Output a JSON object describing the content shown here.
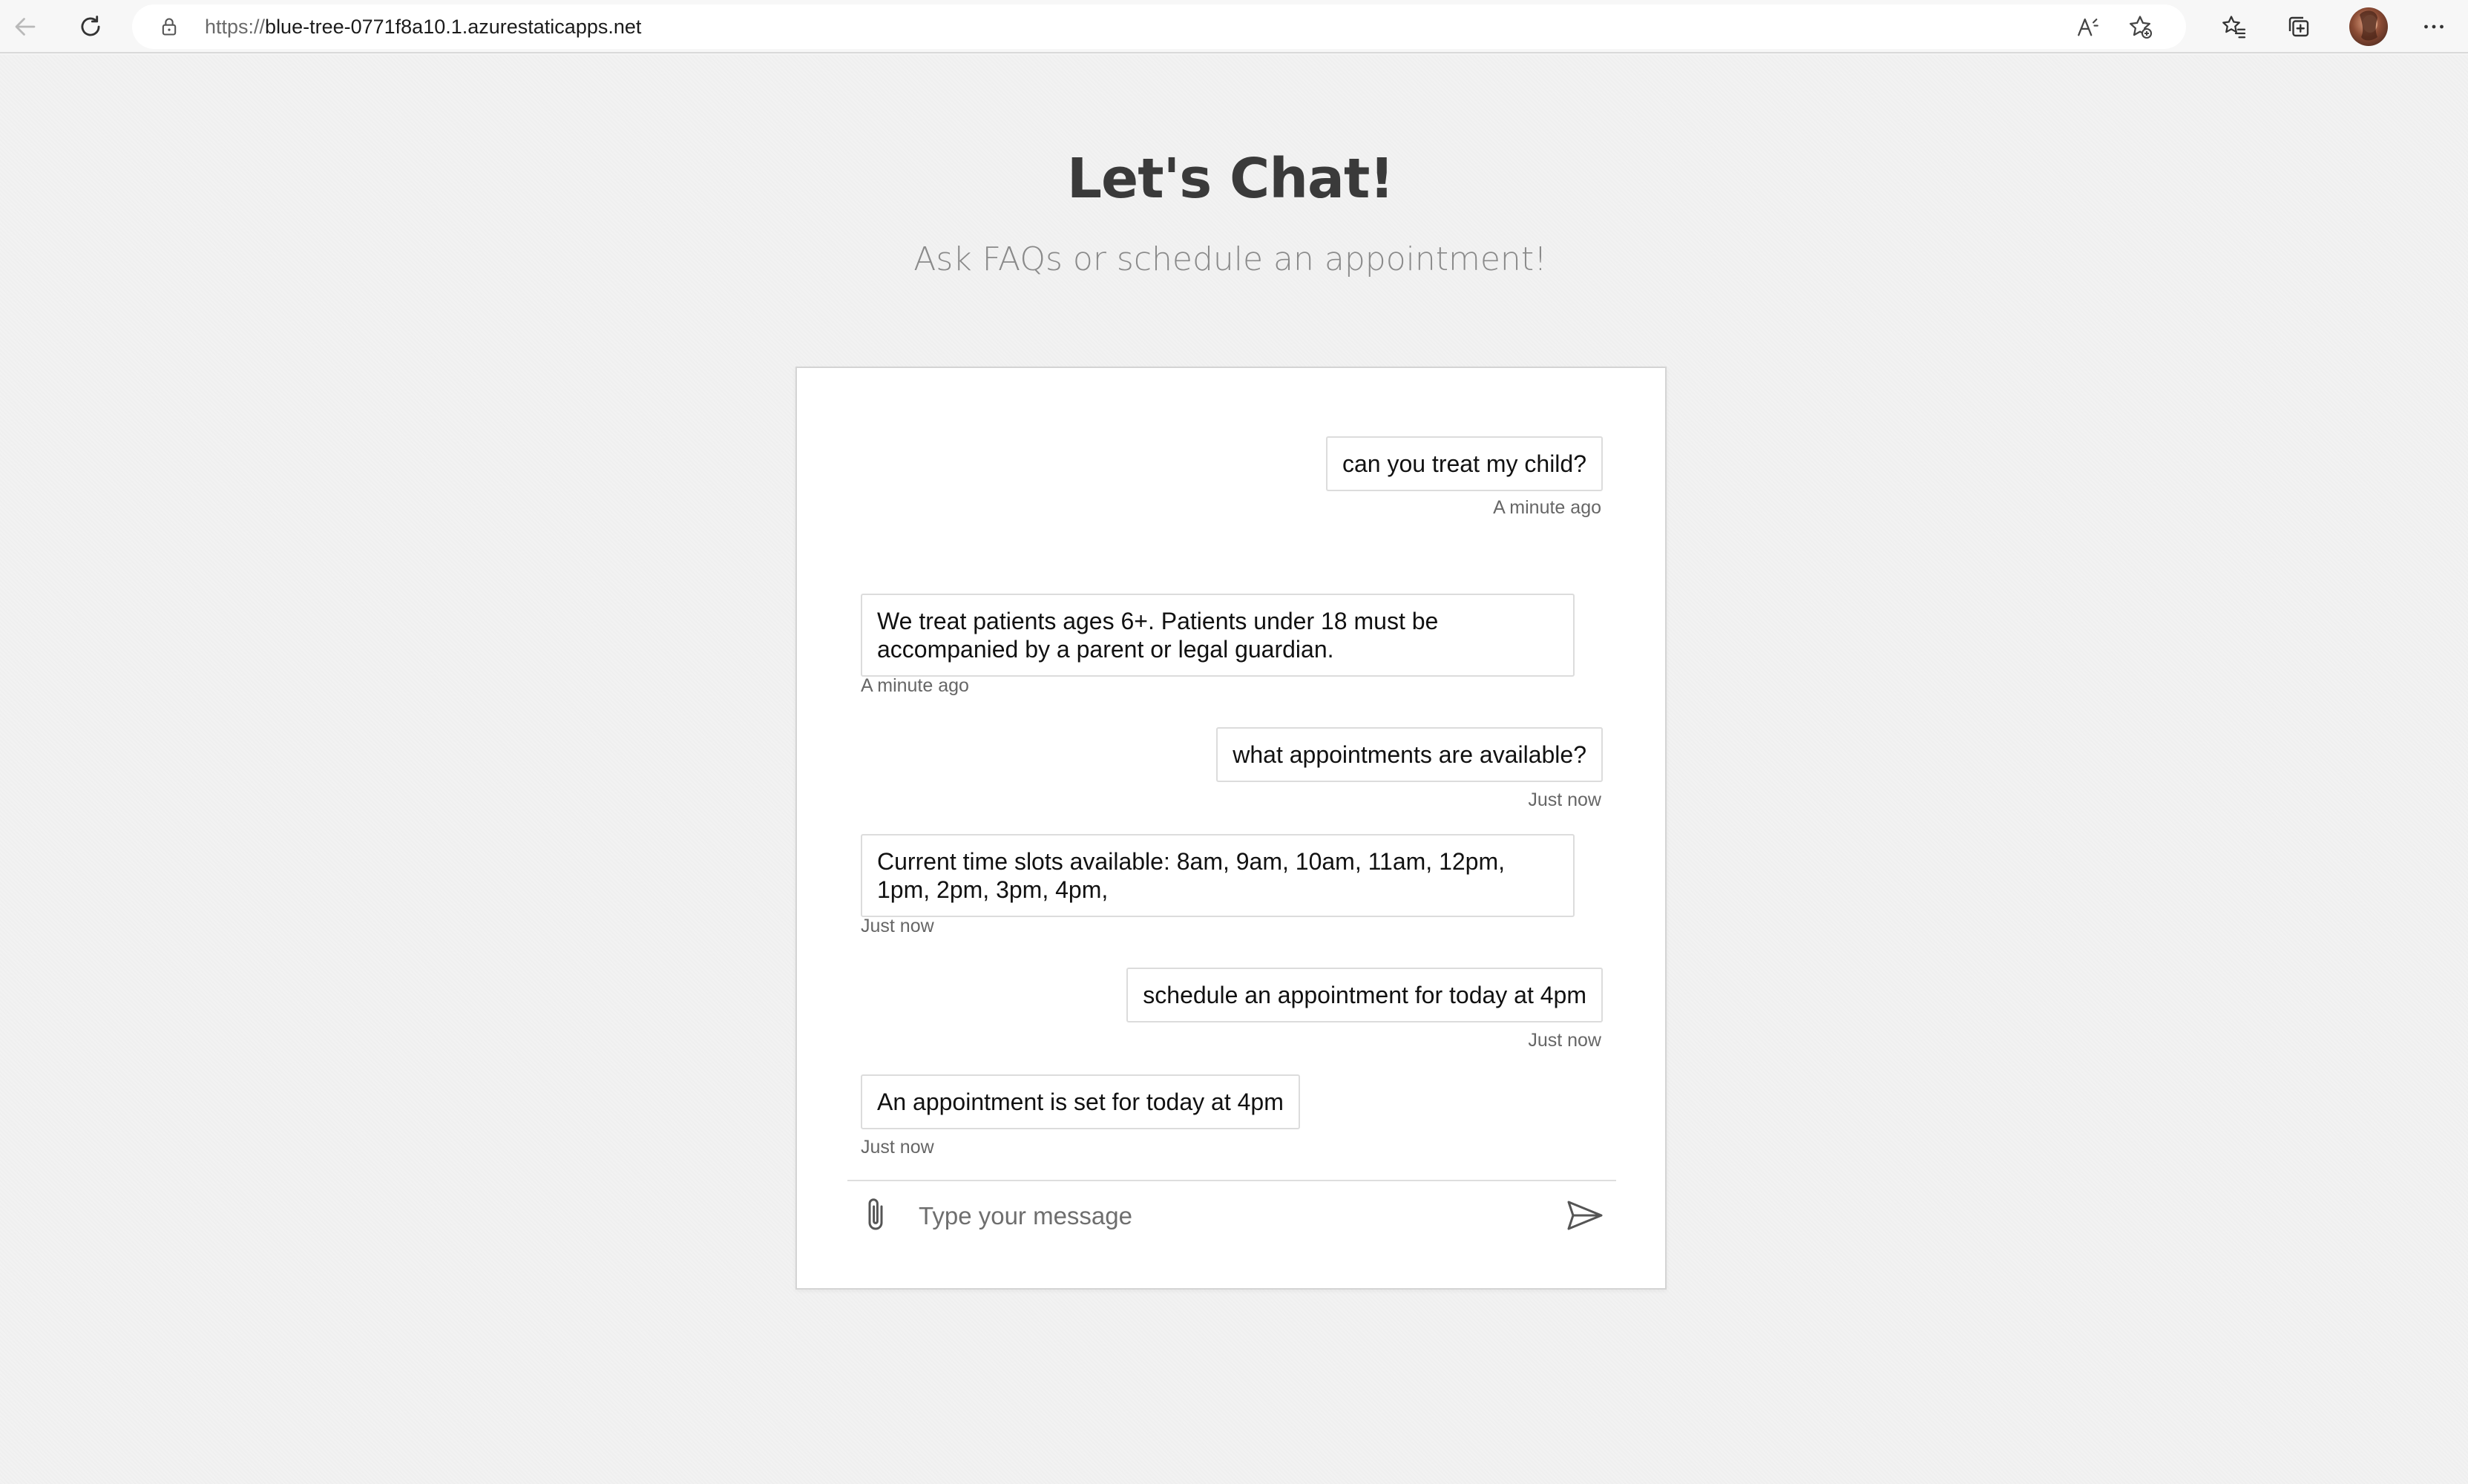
{
  "browser": {
    "url_scheme": "https://",
    "url_host": "blue-tree-0771f8a10.1.azurestaticapps.net"
  },
  "page": {
    "title": "Let's Chat!",
    "subtitle": "Ask FAQs or schedule an appointment!"
  },
  "chat": {
    "messages": [
      {
        "sender": "user",
        "text": "can you treat my child?",
        "time": "A minute ago"
      },
      {
        "sender": "bot",
        "text": "We treat patients ages 6+. Patients under 18 must be accompanied by a parent or legal guardian.",
        "time": "A minute ago"
      },
      {
        "sender": "user",
        "text": "what appointments are available?",
        "time": "Just now"
      },
      {
        "sender": "bot",
        "text": "Current time slots available: 8am, 9am, 10am, 11am, 12pm, 1pm, 2pm, 3pm, 4pm,",
        "time": "Just now"
      },
      {
        "sender": "user",
        "text": "schedule an appointment for today at 4pm",
        "time": "Just now"
      },
      {
        "sender": "bot",
        "text": "An appointment is set for today at 4pm",
        "time": "Just now"
      }
    ],
    "input": {
      "placeholder": "Type your message",
      "value": ""
    }
  },
  "icons": {
    "back": "back-arrow-icon",
    "refresh": "refresh-icon",
    "lock": "lock-icon",
    "read_aloud": "read-aloud-icon",
    "add_favorite": "add-favorite-icon",
    "favorites": "favorites-icon",
    "collections": "collections-icon",
    "more": "more-icon",
    "attach": "paperclip-icon",
    "send": "send-icon"
  }
}
